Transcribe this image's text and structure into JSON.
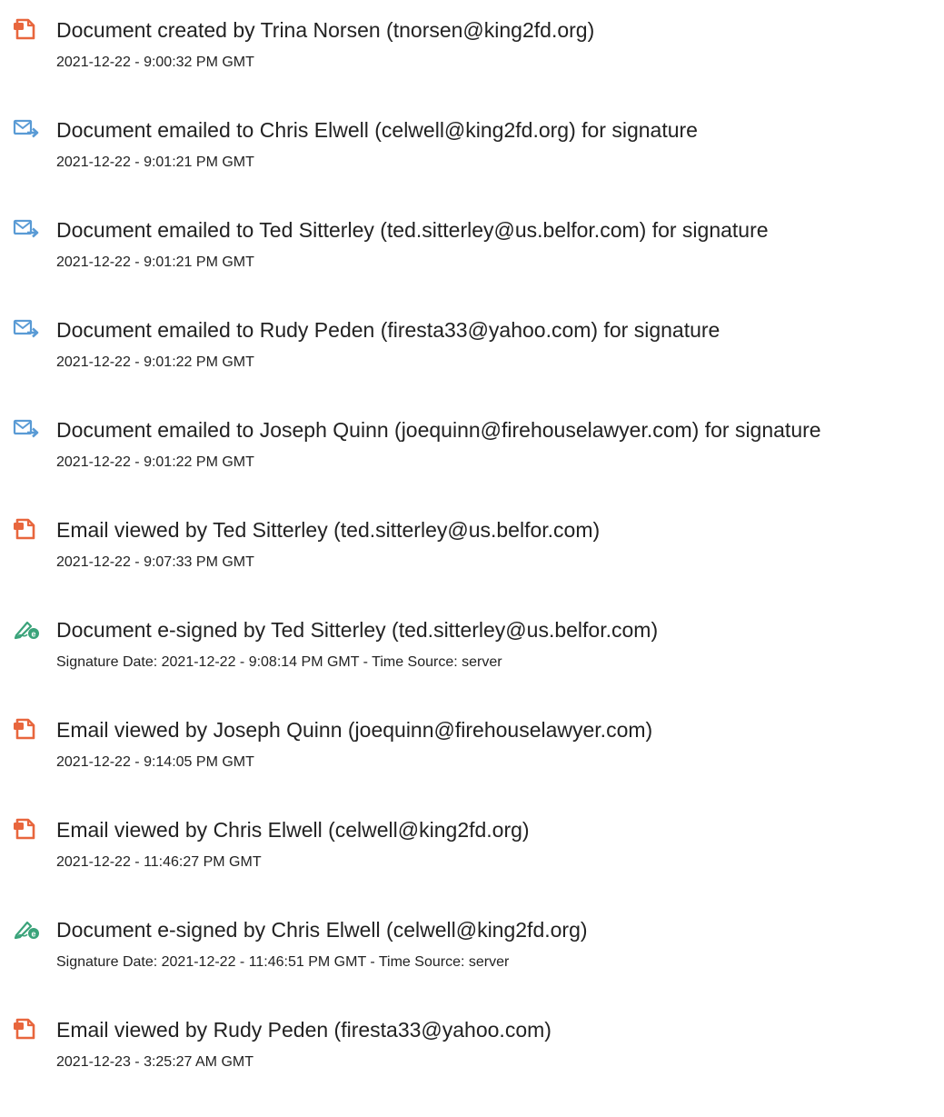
{
  "events": [
    {
      "icon": "document-icon",
      "text": "Document created by Trina Norsen (tnorsen@king2fd.org)",
      "time": "2021-12-22 - 9:00:32 PM GMT"
    },
    {
      "icon": "email-sent-icon",
      "text": "Document emailed to Chris Elwell (celwell@king2fd.org) for signature",
      "time": "2021-12-22 - 9:01:21 PM GMT"
    },
    {
      "icon": "email-sent-icon",
      "text": "Document emailed to Ted Sitterley (ted.sitterley@us.belfor.com) for signature",
      "time": "2021-12-22 - 9:01:21 PM GMT"
    },
    {
      "icon": "email-sent-icon",
      "text": "Document emailed to Rudy Peden (firesta33@yahoo.com) for signature",
      "time": "2021-12-22 - 9:01:22 PM GMT"
    },
    {
      "icon": "email-sent-icon",
      "text": "Document emailed to Joseph Quinn (joequinn@firehouselawyer.com) for signature",
      "time": "2021-12-22 - 9:01:22 PM GMT"
    },
    {
      "icon": "document-icon",
      "text": "Email viewed by Ted Sitterley (ted.sitterley@us.belfor.com)",
      "time": "2021-12-22 - 9:07:33 PM GMT"
    },
    {
      "icon": "esign-icon",
      "text": "Document e-signed by Ted Sitterley (ted.sitterley@us.belfor.com)",
      "time": "Signature Date: 2021-12-22 - 9:08:14 PM GMT - Time Source: server"
    },
    {
      "icon": "document-icon",
      "text": "Email viewed by Joseph Quinn (joequinn@firehouselawyer.com)",
      "time": "2021-12-22 - 9:14:05 PM GMT"
    },
    {
      "icon": "document-icon",
      "text": "Email viewed by Chris Elwell (celwell@king2fd.org)",
      "time": "2021-12-22 - 11:46:27 PM GMT"
    },
    {
      "icon": "esign-icon",
      "text": "Document e-signed by Chris Elwell (celwell@king2fd.org)",
      "time": "Signature Date: 2021-12-22 - 11:46:51 PM GMT - Time Source: server"
    },
    {
      "icon": "document-icon",
      "text": "Email viewed by Rudy Peden (firesta33@yahoo.com)",
      "time": "2021-12-23 - 3:25:27 AM GMT"
    }
  ],
  "colors": {
    "document_icon": "#e8663d",
    "email_icon": "#5a9bd5",
    "esign_icon": "#3aa37a"
  }
}
